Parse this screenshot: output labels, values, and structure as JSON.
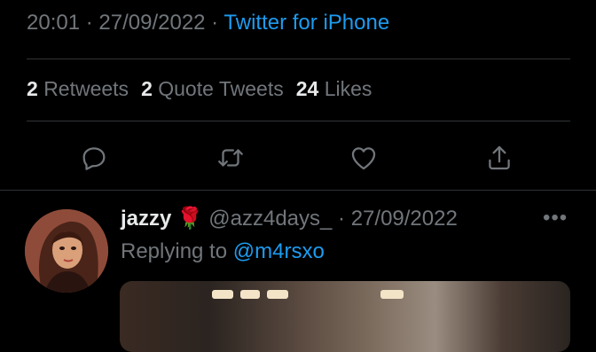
{
  "tweet": {
    "time": "20:01",
    "date": "27/09/2022",
    "separator": " · ",
    "source": "Twitter for iPhone"
  },
  "stats": {
    "retweets_count": "2",
    "retweets_label": "Retweets",
    "quotes_count": "2",
    "quotes_label": "Quote Tweets",
    "likes_count": "24",
    "likes_label": "Likes"
  },
  "actions": {
    "icons": [
      "reply-icon",
      "retweet-icon",
      "like-icon",
      "share-icon"
    ]
  },
  "reply": {
    "display_name": "jazzy",
    "emoji": "🌹",
    "handle": "@azz4days_",
    "separator": " · ",
    "date": "27/09/2022",
    "more": "•••",
    "replying_prefix": "Replying to",
    "replying_to": "@m4rsxo"
  },
  "colors": {
    "background": "#000000",
    "text": "#e7e9ea",
    "secondary": "#71767b",
    "accent": "#1d9bf0",
    "divider": "#2f3336"
  }
}
